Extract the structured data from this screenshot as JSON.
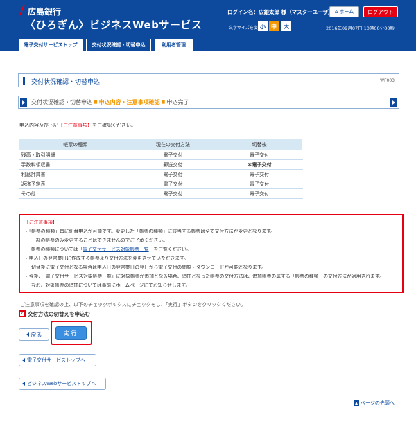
{
  "header": {
    "bank_name": "広島銀行",
    "service_name": "〈ひろぎん〉ビジネスWebサービス",
    "login_label": "ログイン名：広銀太郎 様（マスターユーザ）",
    "home_label": "ホーム",
    "logout_label": "ログアウト",
    "fontsize_label": "文字サイズを変更",
    "fontsize_small": "小",
    "fontsize_mid": "中",
    "fontsize_large": "大",
    "datetime": "2016年09月07日 10時00分00秒"
  },
  "tabs": [
    {
      "label": "電子交付サービストップ"
    },
    {
      "label": "交付状況確認・切替申込"
    },
    {
      "label": "利用者管理"
    }
  ],
  "page": {
    "title": "交付状況確認・切替申込",
    "code": "WF003"
  },
  "steps": [
    {
      "label": "交付状況確認・切替申込",
      "active": false
    },
    {
      "label": "申込内容・注意事項確認",
      "active": true
    },
    {
      "label": "申込完了",
      "active": false
    }
  ],
  "intro": {
    "before": "申込内容及び下記",
    "highlight": "【ご注意事項】",
    "after": "をご確認ください。"
  },
  "table": {
    "headers": [
      "帳票の種類",
      "現在の交付方法",
      "切替後"
    ],
    "rows": [
      [
        "残高・取引明細",
        "電子交付",
        "電子交付"
      ],
      [
        "手数料領収書",
        "郵送交付",
        "＊電子交付"
      ],
      [
        "利息計算書",
        "電子交付",
        "電子交付"
      ],
      [
        "返済予定表",
        "電子交付",
        "電子交付"
      ],
      [
        "その他",
        "電子交付",
        "電子交付"
      ]
    ]
  },
  "notice": {
    "head": "【ご注意事項】",
    "line1": "・「帳票の種類」毎に切替申込が可能です。変更した「帳票の種類」に該当する帳票は全て交付方法が変更となります。",
    "line2": "一部の帳票のみ変更することはできませんのでご了承ください。",
    "line3_before": "帳票の種類については「",
    "line3_link": "電子交付サービス対象帳票一覧",
    "line3_after": "」をご覧ください。",
    "line4": "・申込日の翌営業日に作成する帳票より交付方法を変更させていただきます。",
    "line5": "切替後に電子交付となる場合は申込日の翌営業日の翌日から電子交付の閲覧・ダウンロードが可能となります。",
    "line6": "・今後、「電子交付サービス対象帳票一覧」に対象帳票が追加となる場合、追加となった帳票の交付方法は、追加帳票の属する「帳票の種類」の交付方法が適用されます。",
    "line7": "なお、対象帳票の追加については事前にホームページにてお知らせします。"
  },
  "confirm_text": "ご注意事項を確認の上、以下のチェックボックスにチェックをし、「実行」ボタンをクリックください。",
  "checkbox_label": "交付方法の切替えを申込む",
  "buttons": {
    "back": "戻る",
    "exec": "実行",
    "top_denshi": "電子交付サービストップへ",
    "top_business": "ビジネスWebサービストップへ",
    "page_top": "ページの先頭へ"
  }
}
